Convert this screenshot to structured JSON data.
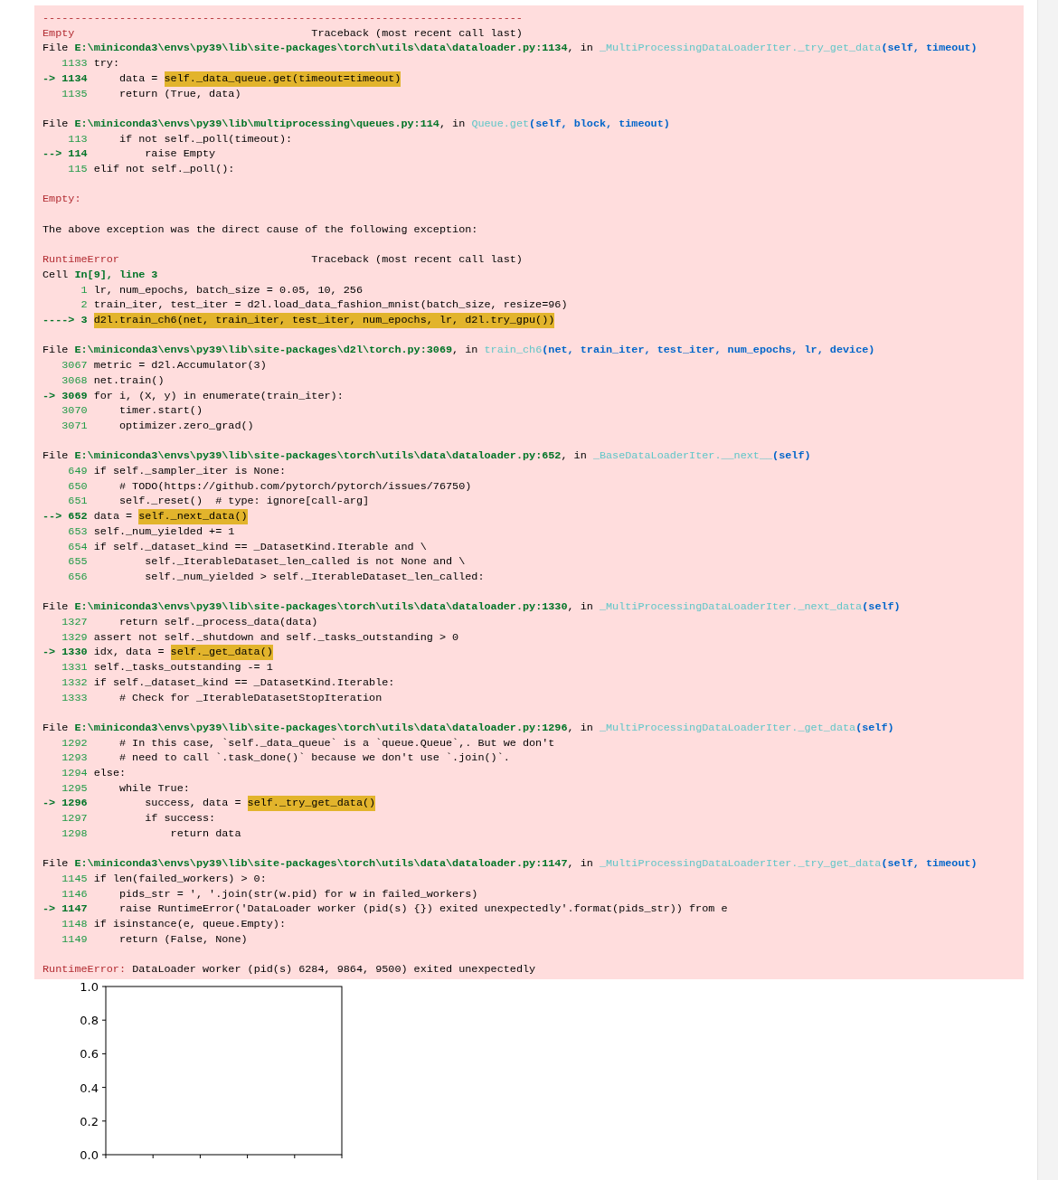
{
  "traceback": {
    "separator": "---------------------------------------------------------------------------",
    "blocks": [
      {
        "kind": "header",
        "error": "Empty",
        "label": "Traceback (most recent call last)"
      },
      {
        "kind": "frame",
        "prefix": "File",
        "path": "E:\\miniconda3\\envs\\py39\\lib\\site-packages\\torch\\utils\\data\\dataloader.py:1134",
        "joiner": ", in",
        "function": "_MultiProcessingDataLoaderIter._try_get_data",
        "args": "(self, timeout)",
        "lines": [
          {
            "number": "1133",
            "code": "try:"
          },
          {
            "arrow": "->",
            "number": "1134",
            "code": "    data = ",
            "highlight": "self._data_queue.get(timeout=timeout)"
          },
          {
            "number": "1135",
            "code": "    return (True, data)"
          }
        ]
      },
      {
        "kind": "frame",
        "prefix": "File",
        "path": "E:\\miniconda3\\envs\\py39\\lib\\multiprocessing\\queues.py:114",
        "joiner": ", in",
        "function": "Queue.get",
        "args": "(self, block, timeout)",
        "lines": [
          {
            "number": "113",
            "code": "    if not self._poll(timeout):"
          },
          {
            "arrow": "-->",
            "number": "114",
            "code": "        raise Empty"
          },
          {
            "number": "115",
            "code": "elif not self._poll():"
          }
        ]
      },
      {
        "kind": "error",
        "name": "Empty:"
      },
      {
        "kind": "message",
        "text": "The above exception was the direct cause of the following exception:"
      },
      {
        "kind": "header",
        "error": "RuntimeError",
        "label": "Traceback (most recent call last)"
      },
      {
        "kind": "frame",
        "prefix": "Cell",
        "path": "In[9], line 3",
        "lines": [
          {
            "number": "1",
            "code": "lr, num_epochs, batch_size = 0.05, 10, 256"
          },
          {
            "number": "2",
            "code": "train_iter, test_iter = d2l.load_data_fashion_mnist(batch_size, resize=96)"
          },
          {
            "arrow": "---->",
            "number": "3",
            "highlight": "d2l.train_ch6(net, train_iter, test_iter, num_epochs, lr, d2l.try_gpu())"
          }
        ]
      },
      {
        "kind": "frame",
        "prefix": "File",
        "path": "E:\\miniconda3\\envs\\py39\\lib\\site-packages\\d2l\\torch.py:3069",
        "joiner": ", in",
        "function": "train_ch6",
        "args": "(net, train_iter, test_iter, num_epochs, lr, device)",
        "lines": [
          {
            "number": "3067",
            "code": "metric = d2l.Accumulator(3)"
          },
          {
            "number": "3068",
            "code": "net.train()"
          },
          {
            "arrow": "->",
            "number": "3069",
            "code": "for i, (X, y) in enumerate(train_iter):"
          },
          {
            "number": "3070",
            "code": "    timer.start()"
          },
          {
            "number": "3071",
            "code": "    optimizer.zero_grad()"
          }
        ]
      },
      {
        "kind": "frame",
        "prefix": "File",
        "path": "E:\\miniconda3\\envs\\py39\\lib\\site-packages\\torch\\utils\\data\\dataloader.py:652",
        "joiner": ", in",
        "function": "_BaseDataLoaderIter.__next__",
        "args": "(self)",
        "lines": [
          {
            "number": "649",
            "code": "if self._sampler_iter is None:"
          },
          {
            "number": "650",
            "code": "    # TODO(https://github.com/pytorch/pytorch/issues/76750)"
          },
          {
            "number": "651",
            "code": "    self._reset()  # type: ignore[call-arg]"
          },
          {
            "arrow": "-->",
            "number": "652",
            "code": "data = ",
            "highlight": "self._next_data()"
          },
          {
            "number": "653",
            "code": "self._num_yielded += 1"
          },
          {
            "number": "654",
            "code": "if self._dataset_kind == _DatasetKind.Iterable and \\"
          },
          {
            "number": "655",
            "code": "        self._IterableDataset_len_called is not None and \\"
          },
          {
            "number": "656",
            "code": "        self._num_yielded > self._IterableDataset_len_called:"
          }
        ]
      },
      {
        "kind": "frame",
        "prefix": "File",
        "path": "E:\\miniconda3\\envs\\py39\\lib\\site-packages\\torch\\utils\\data\\dataloader.py:1330",
        "joiner": ", in",
        "function": "_MultiProcessingDataLoaderIter._next_data",
        "args": "(self)",
        "lines": [
          {
            "number": "1327",
            "code": "    return self._process_data(data)"
          },
          {
            "number": "1329",
            "code": "assert not self._shutdown and self._tasks_outstanding > 0"
          },
          {
            "arrow": "->",
            "number": "1330",
            "code": "idx, data = ",
            "highlight": "self._get_data()"
          },
          {
            "number": "1331",
            "code": "self._tasks_outstanding -= 1"
          },
          {
            "number": "1332",
            "code": "if self._dataset_kind == _DatasetKind.Iterable:"
          },
          {
            "number": "1333",
            "code": "    # Check for _IterableDatasetStopIteration"
          }
        ]
      },
      {
        "kind": "frame",
        "prefix": "File",
        "path": "E:\\miniconda3\\envs\\py39\\lib\\site-packages\\torch\\utils\\data\\dataloader.py:1296",
        "joiner": ", in",
        "function": "_MultiProcessingDataLoaderIter._get_data",
        "args": "(self)",
        "lines": [
          {
            "number": "1292",
            "code": "    # In this case, `self._data_queue` is a `queue.Queue`,. But we don't"
          },
          {
            "number": "1293",
            "code": "    # need to call `.task_done()` because we don't use `.join()`."
          },
          {
            "number": "1294",
            "code": "else:"
          },
          {
            "number": "1295",
            "code": "    while True:"
          },
          {
            "arrow": "->",
            "number": "1296",
            "code": "        success, data = ",
            "highlight": "self._try_get_data()"
          },
          {
            "number": "1297",
            "code": "        if success:"
          },
          {
            "number": "1298",
            "code": "            return data"
          }
        ]
      },
      {
        "kind": "frame",
        "prefix": "File",
        "path": "E:\\miniconda3\\envs\\py39\\lib\\site-packages\\torch\\utils\\data\\dataloader.py:1147",
        "joiner": ", in",
        "function": "_MultiProcessingDataLoaderIter._try_get_data",
        "args": "(self, timeout)",
        "lines": [
          {
            "number": "1145",
            "code": "if len(failed_workers) > 0:"
          },
          {
            "number": "1146",
            "code": "    pids_str = ', '.join(str(w.pid) for w in failed_workers)"
          },
          {
            "arrow": "->",
            "number": "1147",
            "code": "    raise RuntimeError('DataLoader worker (pid(s) {}) exited unexpectedly'.format(pids_str)) from e"
          },
          {
            "number": "1148",
            "code": "if isinstance(e, queue.Empty):"
          },
          {
            "number": "1149",
            "code": "    return (False, None)"
          }
        ]
      },
      {
        "kind": "error",
        "name": "RuntimeError:",
        "message": "DataLoader worker (pid(s) 6284, 9864, 9500) exited unexpectedly"
      }
    ]
  },
  "empty_plot": {
    "y_tick_labels": [
      "1.0",
      "0.8",
      "0.6",
      "0.4",
      "0.2",
      "0.0"
    ]
  }
}
